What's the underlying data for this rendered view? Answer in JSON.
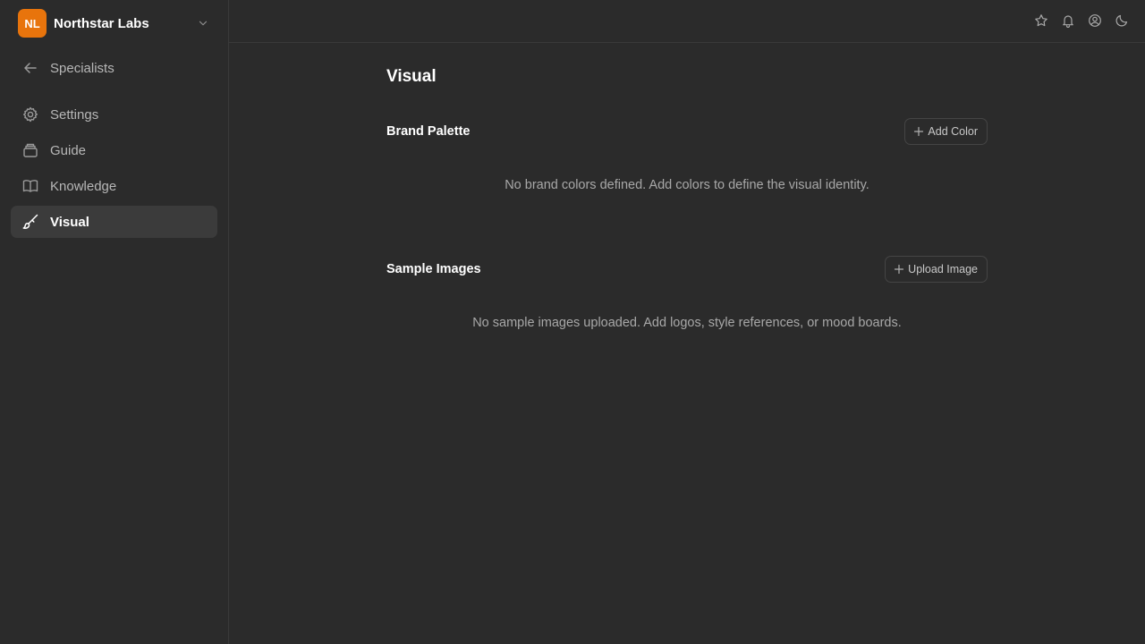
{
  "org": {
    "initials": "NL",
    "name": "Northstar Labs",
    "accent": "#e8740c"
  },
  "sidebar": {
    "back_label": "Specialists",
    "items": [
      {
        "label": "Settings",
        "icon": "gear-icon"
      },
      {
        "label": "Guide",
        "icon": "archive-icon"
      },
      {
        "label": "Knowledge",
        "icon": "book-icon"
      },
      {
        "label": "Visual",
        "icon": "brush-icon",
        "active": true
      }
    ]
  },
  "topbar": {
    "icons": [
      "star-icon",
      "bell-icon",
      "user-circle-icon",
      "moon-icon"
    ]
  },
  "main": {
    "title": "Visual",
    "brand_palette": {
      "title": "Brand Palette",
      "button_label": "Add Color",
      "empty_text": "No brand colors defined. Add colors to define the visual identity."
    },
    "sample_images": {
      "title": "Sample Images",
      "button_label": "Upload Image",
      "empty_text": "No sample images uploaded. Add logos, style references, or mood boards."
    }
  }
}
